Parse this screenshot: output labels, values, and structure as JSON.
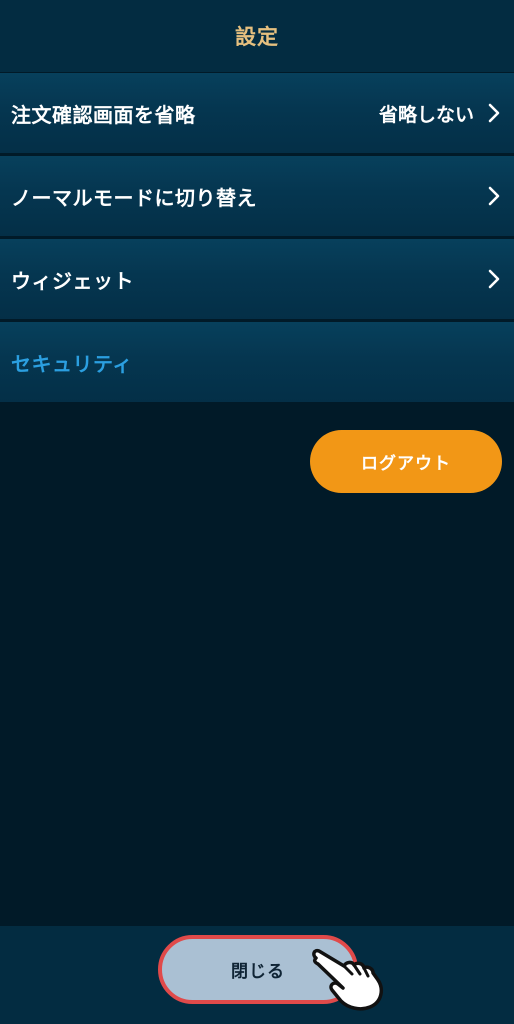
{
  "header": {
    "title": "設定"
  },
  "settings": {
    "items": [
      {
        "label": "注文確認画面を省略",
        "value": "省略しない",
        "icon": "chevron-right-icon"
      },
      {
        "label": "ノーマルモードに切り替え",
        "value": "",
        "icon": "chevron-right-icon"
      },
      {
        "label": "ウィジェット",
        "value": "",
        "icon": "chevron-right-icon"
      }
    ],
    "section_label": "セキュリティ"
  },
  "logout": {
    "label": "ログアウト"
  },
  "footer": {
    "close_label": "閉じる",
    "pointer_icon": "hand-pointer-icon"
  },
  "colors": {
    "background": "#011a28",
    "header": "#032c41",
    "title": "#e6c07f",
    "section": "#2b9fe0",
    "logout": "#f29716",
    "close_button": "#aac0d3",
    "highlight": "#e04a4a"
  }
}
